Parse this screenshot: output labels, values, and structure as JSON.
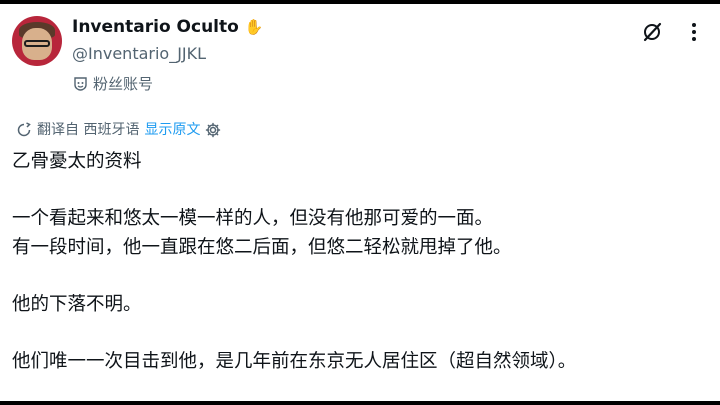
{
  "author": {
    "display_name": "Inventario Oculto",
    "badge_icon": "raised-hand-emoji",
    "handle": "@Inventario_JJKL",
    "account_label": "粉丝账号",
    "avatar_color": "#b8263b"
  },
  "top_actions": {
    "grok_icon": "grok-icon",
    "more_icon": "more-icon"
  },
  "translation": {
    "translated_from": "翻译自 西班牙语",
    "show_original": "显示原文",
    "accent_color": "#1d9bf0"
  },
  "post": {
    "title": "乙骨憂太的资料",
    "line1": "一个看起来和悠太一模一样的人，但没有他那可爱的一面。",
    "line2": "有一段时间，他一直跟在悠二后面，但悠二轻松就甩掉了他。",
    "line3": "他的下落不明。",
    "line4": "他们唯一一次目击到他，是几年前在东京无人居住区（超自然领域）。"
  }
}
